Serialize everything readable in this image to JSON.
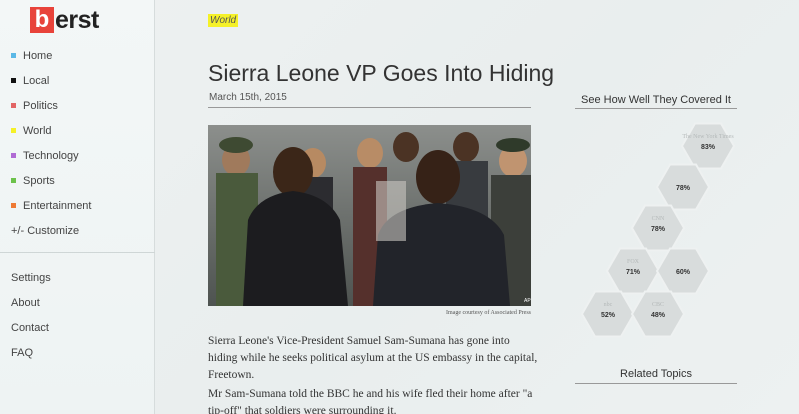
{
  "logo": {
    "initial": "b",
    "rest": "erst"
  },
  "nav": [
    {
      "label": "Home",
      "color": "#5bb8e6"
    },
    {
      "label": "Local",
      "color": "#111111"
    },
    {
      "label": "Politics",
      "color": "#e26565"
    },
    {
      "label": "World",
      "color": "#f5f128"
    },
    {
      "label": "Technology",
      "color": "#b06bd4"
    },
    {
      "label": "Sports",
      "color": "#6cc24a"
    },
    {
      "label": "Entertainment",
      "color": "#ee7a35"
    },
    {
      "label": "+/- Customize",
      "color": ""
    }
  ],
  "secondary_nav": [
    "Settings",
    "About",
    "Contact",
    "FAQ"
  ],
  "article": {
    "section": "World",
    "headline": "Sierra Leone VP Goes Into Hiding",
    "date": "March 15th, 2015",
    "image_caption": "Image courtesy of Associated Press",
    "paragraphs": [
      "Sierra Leone's Vice-President Samuel Sam-Sumana has gone into hiding while he seeks political asylum at the US embassy in the capital, Freetown.",
      "Mr Sam-Sumana told the BBC he and his wife fled their home after \"a tip-off\" that soldiers were surrounding it."
    ]
  },
  "coverage": {
    "title": "See How Well They Covered It",
    "outlets": [
      {
        "logo": "The New York Times",
        "score": "83%"
      },
      {
        "logo": "",
        "score": "78%"
      },
      {
        "logo": "CNN",
        "score": "78%"
      },
      {
        "logo": "FOX",
        "score": "71%"
      },
      {
        "logo": "",
        "score": "60%"
      },
      {
        "logo": "nbc",
        "score": "52%"
      },
      {
        "logo": "CBC",
        "score": "48%"
      }
    ]
  },
  "related": {
    "title": "Related Topics"
  }
}
